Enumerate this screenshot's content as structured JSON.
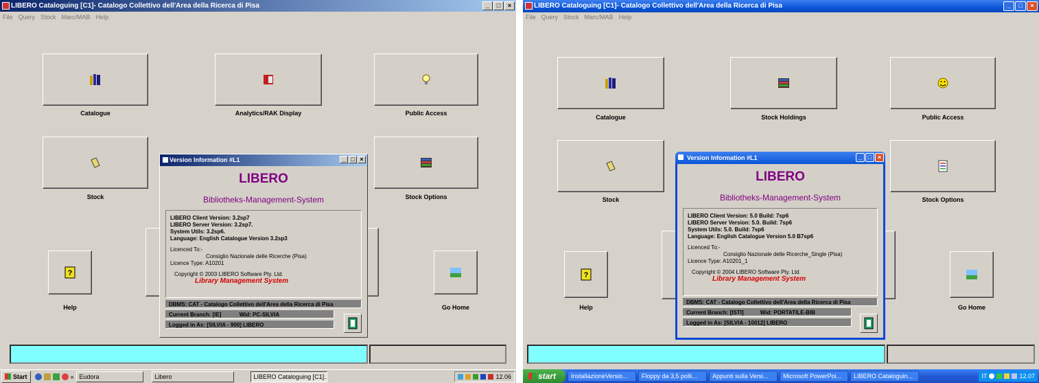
{
  "left": {
    "window_title": "LIBERO Cataloguing  [C1]- Catalogo Collettivo dell'Area della Ricerca di Pisa",
    "window_buttons": [
      "_",
      "□",
      "×"
    ],
    "menu": [
      "File",
      "Query",
      "Stock",
      "Marc/MAB",
      "Help"
    ],
    "tiles": {
      "catalogue": "Catalogue",
      "analytics": "Analytics/RAK Display",
      "public_access": "Public Access",
      "stock": "Stock",
      "stock_options": "Stock Options",
      "help": "Help",
      "go_home": "Go Home"
    },
    "dialog": {
      "title": "Version Information #L1",
      "buttons": [
        "_",
        "□",
        "×"
      ],
      "product": "LIBERO",
      "subtitle": "Bibliotheks-Management-System",
      "client": "LIBERO Client Version: 3.2sp7",
      "server": "LIBERO Server Version: 3.2sp7.",
      "utils": "System Utils: 3.2sp6.",
      "language": "Language: English Catalogue Version 3.2sp3",
      "licenced_to": "Licenced To:-",
      "org": "Consiglio Nazionale delle Ricerche (Pisa)",
      "licence_type": "Licence Type: A10201",
      "copyright": "Copyright © 2003 LIBERO Software Pty. Ltd.",
      "lms": "Library Management System",
      "dbms": "DBMS: CAT - Catalogo Collettivo dell'Area della Ricerca di Pisa",
      "branch": "Current Branch: [IE]",
      "wid": "Wid: PC-SILVIA",
      "logged": "Logged in As: [SILVIA - 900] LIBERO"
    },
    "taskbar": {
      "start": "Start",
      "chevron": "»",
      "items": [
        "Eudora",
        "Libero",
        "LIBERO Cataloguing [C1]..."
      ],
      "clock": "12.06"
    }
  },
  "right": {
    "window_title": "LIBERO Cataloguing  [C1]- Catalogo Collettivo dell'Area della Ricerca di Pisa",
    "window_buttons": [
      "_",
      "□",
      "×"
    ],
    "menu": [
      "File",
      "Query",
      "Stock",
      "Marc/MAB",
      "Help"
    ],
    "tiles": {
      "catalogue": "Catalogue",
      "stock_holdings": "Stock Holdings",
      "public_access": "Public Access",
      "stock": "Stock",
      "stock_options": "Stock Options",
      "help": "Help",
      "go_home": "Go Home"
    },
    "dialog": {
      "title": "Version Information #L1",
      "buttons": [
        "_",
        "□",
        "×"
      ],
      "product": "LIBERO",
      "subtitle": "Bibliotheks-Management-System",
      "client": "LIBERO Client Version: 5.0  Build: 7sp6",
      "server": "LIBERO Server Version: 5.0.  Build: 7sp6",
      "utils": "System Utils: 5.0.  Build: 7sp6",
      "language": "Language: English Catalogue Version 5.0 B7sp6",
      "licenced_to": "Licenced To:-",
      "org": "Consiglio Nazionale delle Ricerche_Single (Pisa)",
      "licence_type": "Licence Type: A10201_1",
      "copyright": "Copyright © 2004 LIBERO Software Pty. Ltd.",
      "lms": "Library Management System",
      "dbms": "DBMS: CAT - Catalogo Collettivo dell'Area della Ricerca di Pisa",
      "branch": "Current Branch: [ISTI]",
      "wid": "Wid: PORTATILE-BIB",
      "logged": "Logged in As: [SILVIA - 10012] LIBERO"
    },
    "taskbar": {
      "start": "start",
      "items": [
        "InstallazioneVersio...",
        "Floppy da 3,5 polli...",
        "Appunti sulla Versi...",
        "Microsoft PowerPoi...",
        "LIBERO Cataloguin..."
      ],
      "lang": "IT",
      "clock": "12.07"
    }
  },
  "colors": {
    "desktop": "#d6d2c9",
    "status_cyan": "#7fffff",
    "libero_purple": "#800080",
    "lms_red": "#d40000",
    "xp_blue": "#0a56d8"
  },
  "icons": {
    "catalogue": "books-icon",
    "analytics": "red-book-icon",
    "public_access_left": "lightbulb-icon",
    "public_access_right": "smiley-icon",
    "stock": "eraser-icon",
    "stock_options": "bookshelf-icon",
    "stock_holdings": "bookshelf-icon",
    "help": "help-book-icon",
    "go_home": "landscape-icon",
    "exit": "exit-door-icon"
  }
}
